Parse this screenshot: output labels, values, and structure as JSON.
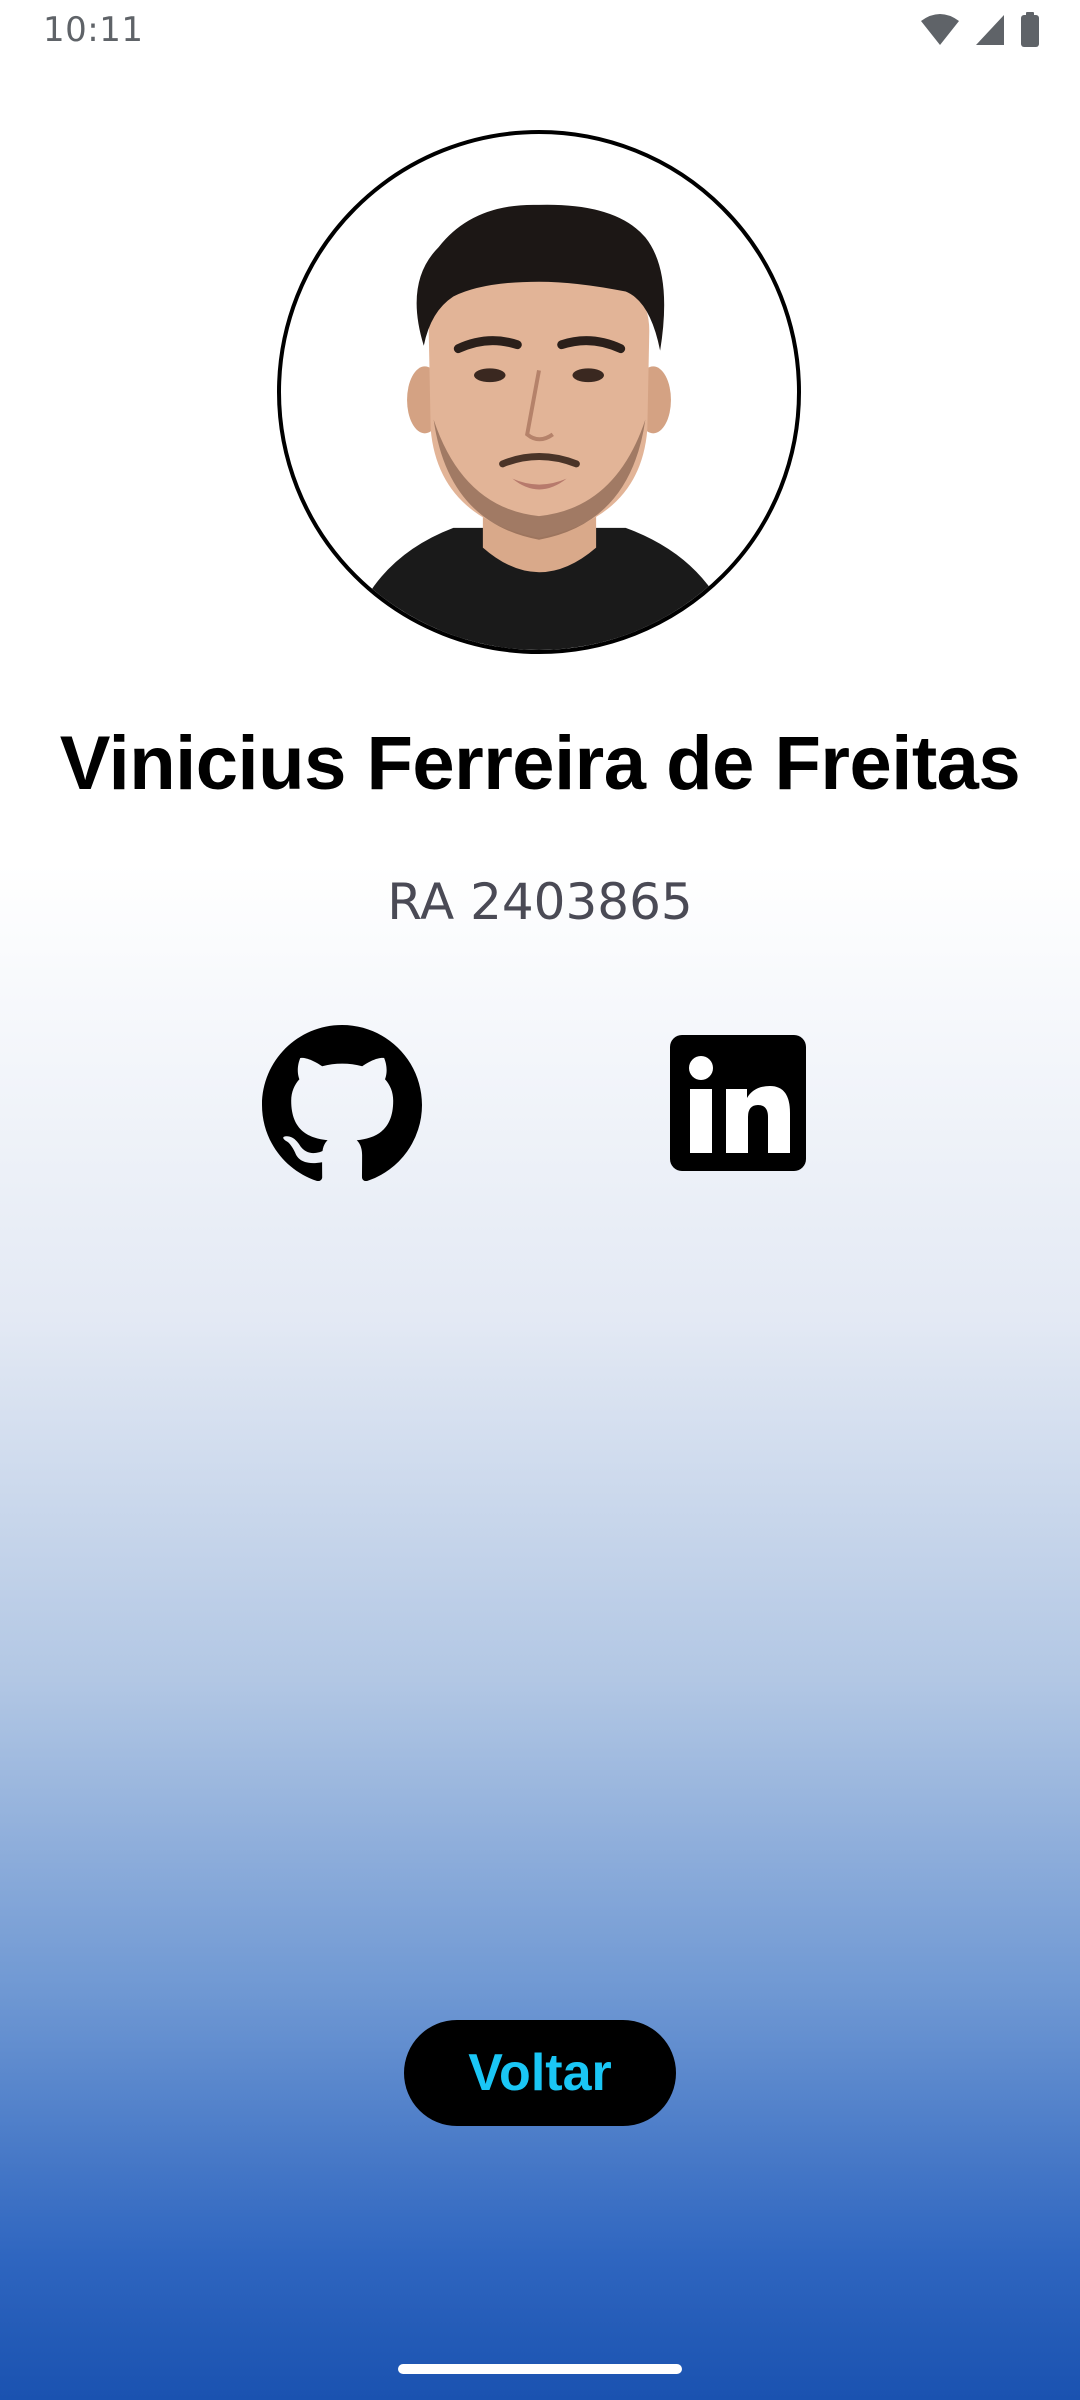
{
  "status_bar": {
    "time": "10:11",
    "icons": [
      "wifi-icon",
      "cell-signal-icon",
      "battery-icon"
    ]
  },
  "profile": {
    "name": "Vinicius Ferreira de Freitas",
    "ra": "RA 2403865"
  },
  "social": {
    "github_icon": "github-icon",
    "linkedin_icon": "linkedin-icon"
  },
  "actions": {
    "back_label": "Voltar"
  },
  "colors": {
    "background_top": "#ffffff",
    "background_bottom": "#1a52b0",
    "button_bg": "#000000",
    "button_text": "#1ac6f5"
  }
}
